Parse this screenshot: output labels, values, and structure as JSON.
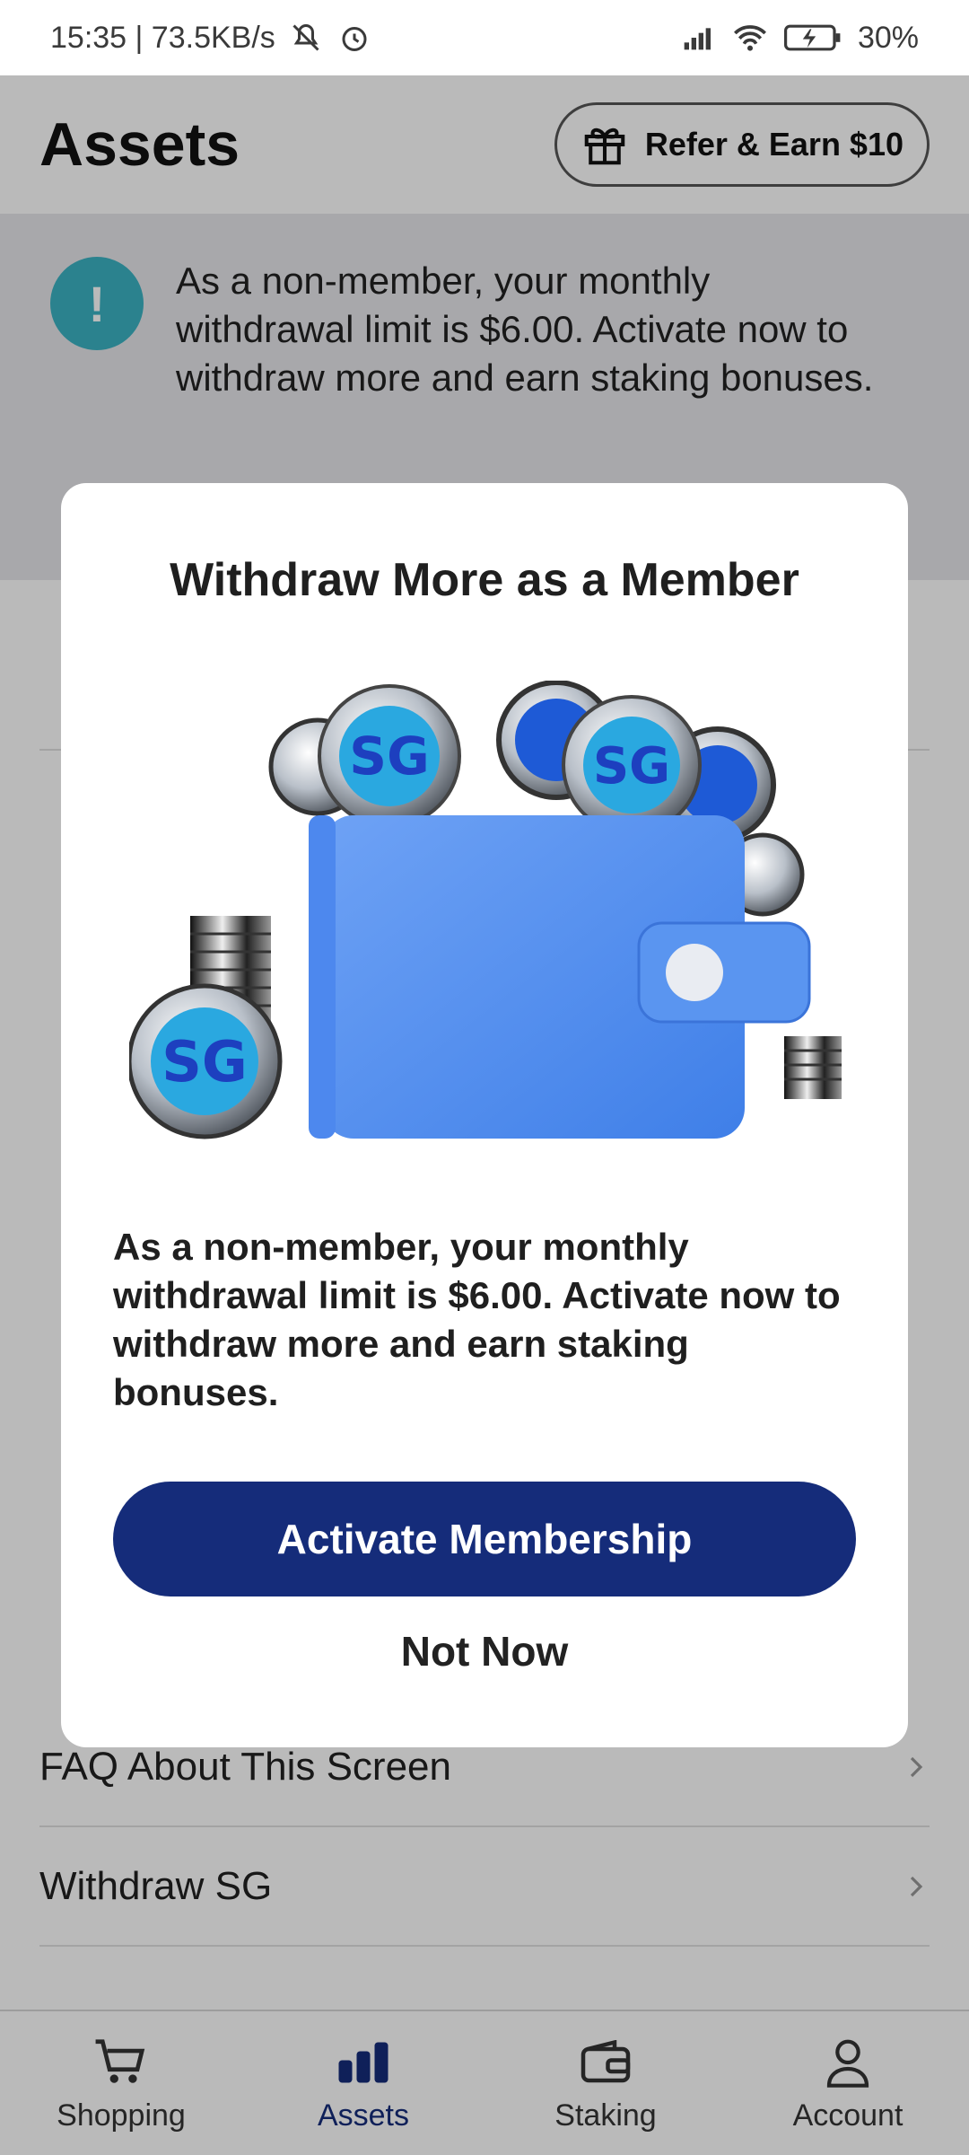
{
  "status_bar": {
    "time_speed": "15:35 | 73.5KB/s",
    "battery": "30%"
  },
  "header": {
    "title": "Assets",
    "refer_label": "Refer & Earn $10"
  },
  "notice": {
    "badge": "!",
    "text": "As a non-member, your monthly withdrawal limit is $6.00. Activate now to withdraw more and earn staking bonuses."
  },
  "list": {
    "rows": [
      {
        "label": "FAQ About This Screen"
      },
      {
        "label": "Withdraw SG"
      }
    ]
  },
  "modal": {
    "title": "Withdraw More as a Member",
    "body": "As a non-member, your monthly withdrawal limit is $6.00. Activate now to withdraw more and earn staking bonuses.",
    "primary_button": "Activate Membership",
    "secondary_button": "Not Now",
    "coin_label": "SG"
  },
  "bottom_nav": {
    "items": [
      {
        "label": "Shopping",
        "icon": "cart-icon"
      },
      {
        "label": "Assets",
        "icon": "bar-chart-icon",
        "active": true
      },
      {
        "label": "Staking",
        "icon": "wallet-icon"
      },
      {
        "label": "Account",
        "icon": "person-icon"
      }
    ]
  },
  "colors": {
    "primary": "#152c7a",
    "accent_blue": "#1e88d6",
    "notice_badge": "#3bb3c3",
    "wallet_blue": "#5b93ef"
  }
}
